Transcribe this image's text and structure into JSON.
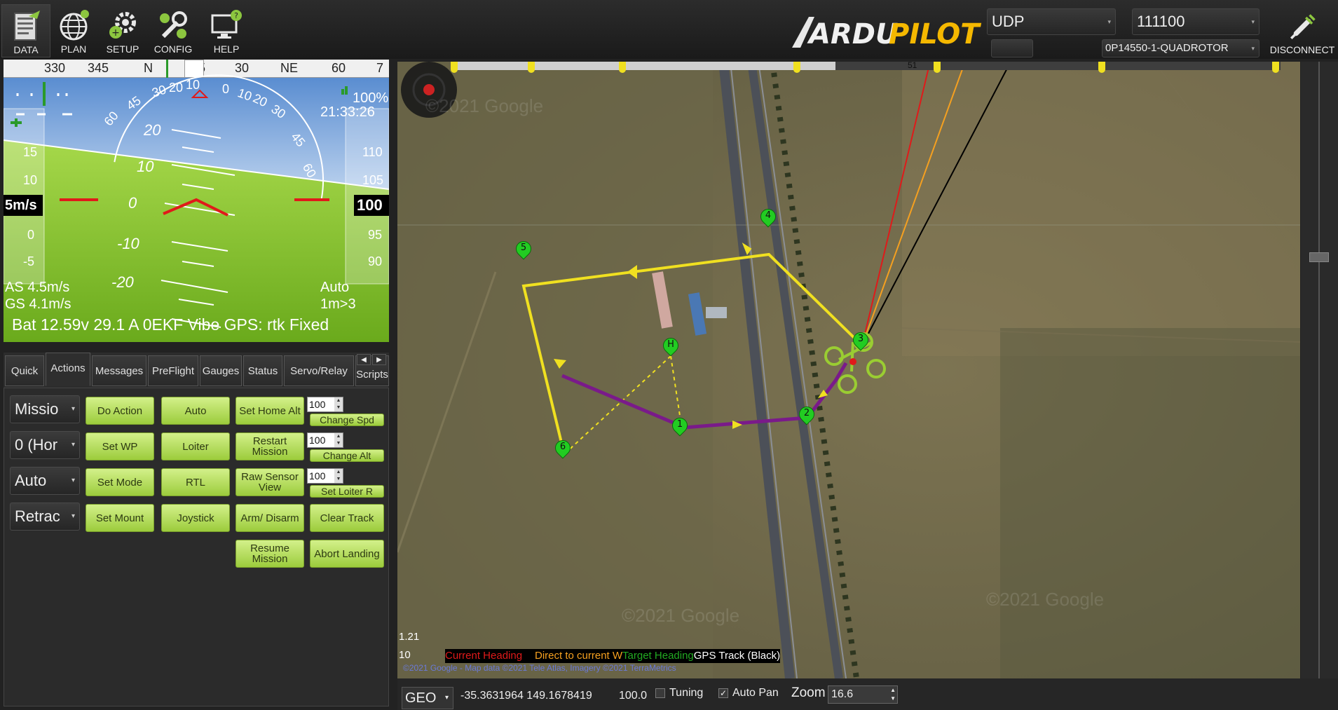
{
  "colors": {
    "accent_green": "#a8d44a",
    "flight_path": "#f0e020",
    "track": "#7a1a8a",
    "waypoint": "#22cc22",
    "heading_red": "#e01a1a",
    "direct_orange": "#f5a020",
    "gps_black": "#000000"
  },
  "nav": [
    {
      "label": "DATA",
      "icon": "data-icon"
    },
    {
      "label": "PLAN",
      "icon": "globe-icon"
    },
    {
      "label": "SETUP",
      "icon": "gears-icon"
    },
    {
      "label": "CONFIG",
      "icon": "wrench-icon"
    },
    {
      "label": "HELP",
      "icon": "monitor-help-icon"
    }
  ],
  "logo_text": "ARDUPILOT",
  "connection": {
    "type": "UDP",
    "port": "111100",
    "vehicle": "0P14550-1-QUADROTOR",
    "disconnect": "DISCONNECT"
  },
  "hud": {
    "compass_ticks": [
      "330",
      "345",
      "N",
      "15",
      "30",
      "NE",
      "60",
      "7"
    ],
    "roll_ticks": [
      "60",
      "45",
      "30",
      "20",
      "10",
      "0",
      "10",
      "20",
      "30",
      "45",
      "60"
    ],
    "pitch_ticks": [
      "20",
      "10",
      "0",
      "-10",
      "-20"
    ],
    "speed_ticks": [
      "15",
      "10",
      "0",
      "-5"
    ],
    "alt_ticks": [
      "110",
      "105",
      "95",
      "90"
    ],
    "speed_value": "5m/s",
    "alt_value": "100",
    "battery_pct": "100%",
    "time": "21:33:26",
    "airspeed": "AS 4.5m/s",
    "groundspeed": "GS 4.1m/s",
    "mode": "Auto",
    "wp_info": "1m>3",
    "status_line": "Bat 12.59v 29.1 A 0EKF Vibe GPS: rtk Fixed"
  },
  "tabs": [
    "Quick",
    "Actions",
    "Messages",
    "PreFlight",
    "Gauges",
    "Status",
    "Servo/Relay",
    "Scripts"
  ],
  "active_tab": "Actions",
  "actions": {
    "dropdowns": [
      "Missio",
      "0 (Hor",
      "Auto",
      "Retrac"
    ],
    "col1": [
      "Do Action",
      "Set WP",
      "Set Mode",
      "Set Mount"
    ],
    "col2": [
      "Auto",
      "Loiter",
      "RTL",
      "Joystick"
    ],
    "col3": [
      "Set Home Alt",
      "Restart Mission",
      "Raw Sensor View",
      "Arm/ Disarm",
      "Resume Mission"
    ],
    "col4": [
      "Change Spd",
      "Change Alt",
      "Set Loiter R",
      "Clear Track",
      "Abort Landing"
    ],
    "spin_values": [
      "100",
      "100",
      "100"
    ]
  },
  "map": {
    "progress_value": "51",
    "waypoints": [
      "1",
      "2",
      "3",
      "4",
      "5",
      "6",
      "H"
    ],
    "scale_top": "1.21",
    "scale_bottom": "10",
    "legend": {
      "current_heading": "Current Heading",
      "direct_to_current": "Direct to current W",
      "target_heading": "Target Heading",
      "gps_track": "GPS Track (Black)"
    },
    "copyright": "©2021 Google - Map data ©2021 Tele Atlas, Imagery ©2021 TerraMetrics",
    "watermarks": [
      "©2021 Google",
      "©2021 Google",
      "©2021 Google"
    ]
  },
  "bottom": {
    "geo": "GEO",
    "coords": "-35.3631964 149.1678419",
    "alt": "100.0",
    "tuning_label": "Tuning",
    "tuning_checked": false,
    "autopan_label": "Auto Pan",
    "autopan_checked": true,
    "zoom_label": "Zoom",
    "zoom_value": "16.6"
  }
}
